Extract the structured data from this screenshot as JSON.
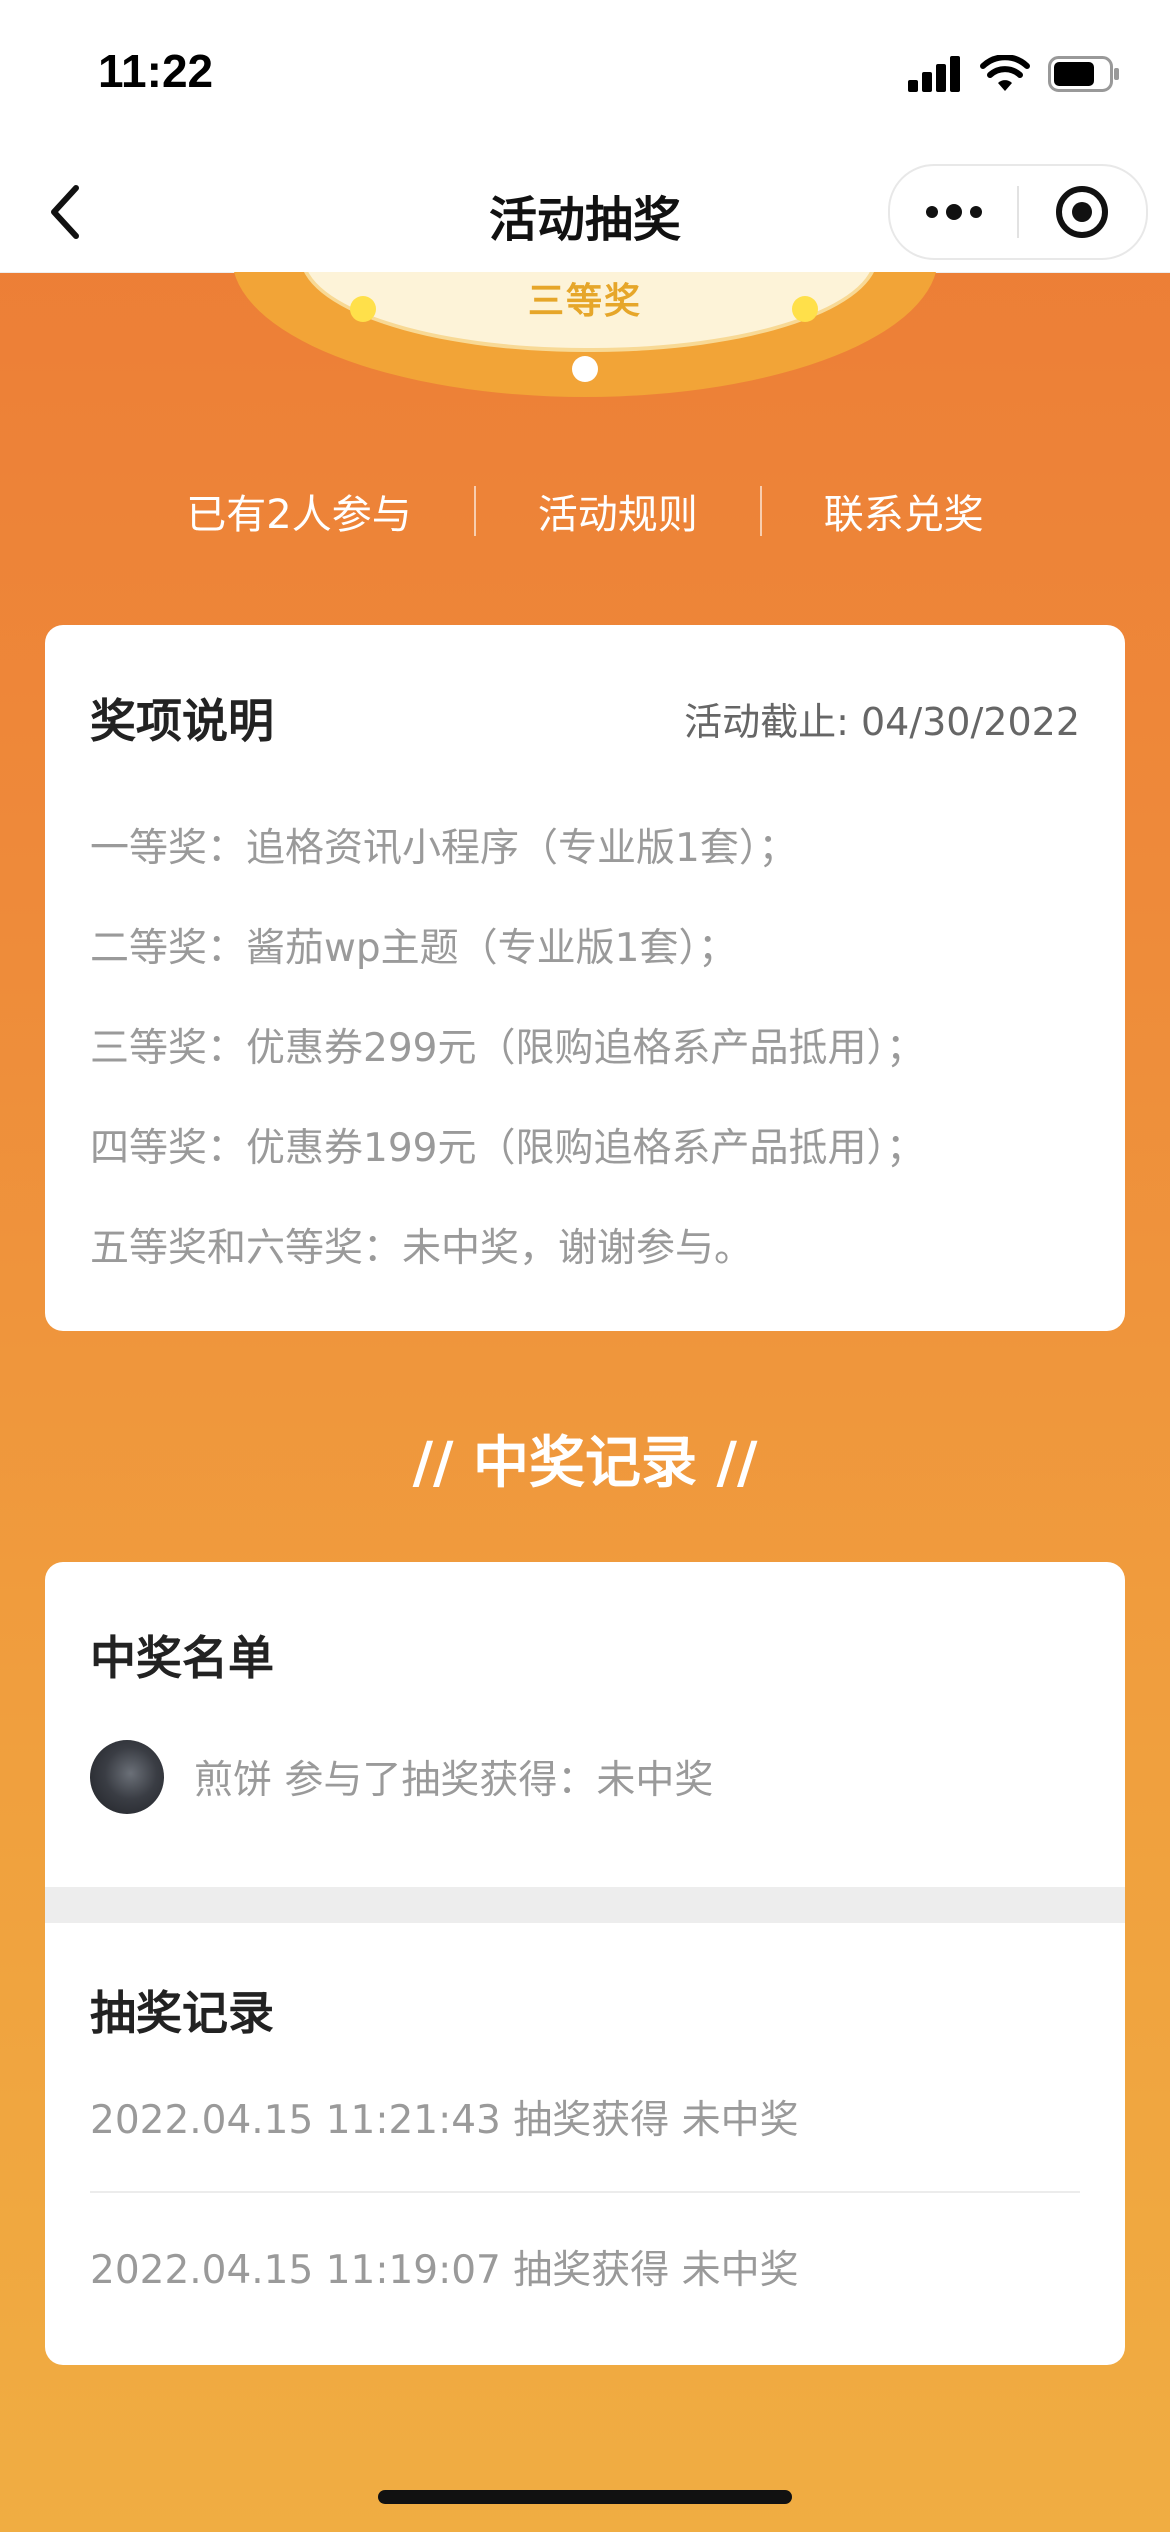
{
  "status_bar": {
    "time": "11:22"
  },
  "nav": {
    "title": "活动抽奖"
  },
  "wheel": {
    "peek_text": "三等奖"
  },
  "links": [
    "已有2人参与",
    "活动规则",
    "联系兑奖"
  ],
  "prize_card": {
    "title": "奖项说明",
    "deadline": "活动截止: 04/30/2022",
    "items": [
      "一等奖：追格资讯小程序（专业版1套）；",
      "二等奖：酱茄wp主题（专业版1套）；",
      "三等奖：优惠券299元（限购追格系产品抵用）；",
      "四等奖：优惠券199元（限购追格系产品抵用）；",
      "五等奖和六等奖：未中奖，谢谢参与。"
    ]
  },
  "section_title": "// 中奖记录 //",
  "winners": {
    "title": "中奖名单",
    "rows": [
      {
        "text": "煎饼 参与了抽奖获得：未中奖"
      }
    ]
  },
  "draws": {
    "title": "抽奖记录",
    "rows": [
      {
        "text": "2022.04.15 11:21:43 抽奖获得 未中奖"
      },
      {
        "text": "2022.04.15 11:19:07 抽奖获得 未中奖"
      }
    ]
  },
  "colors": {
    "background_top": "#ec7a35",
    "background_bottom": "#f0ad42",
    "wheel_rim": "#f2a437"
  }
}
